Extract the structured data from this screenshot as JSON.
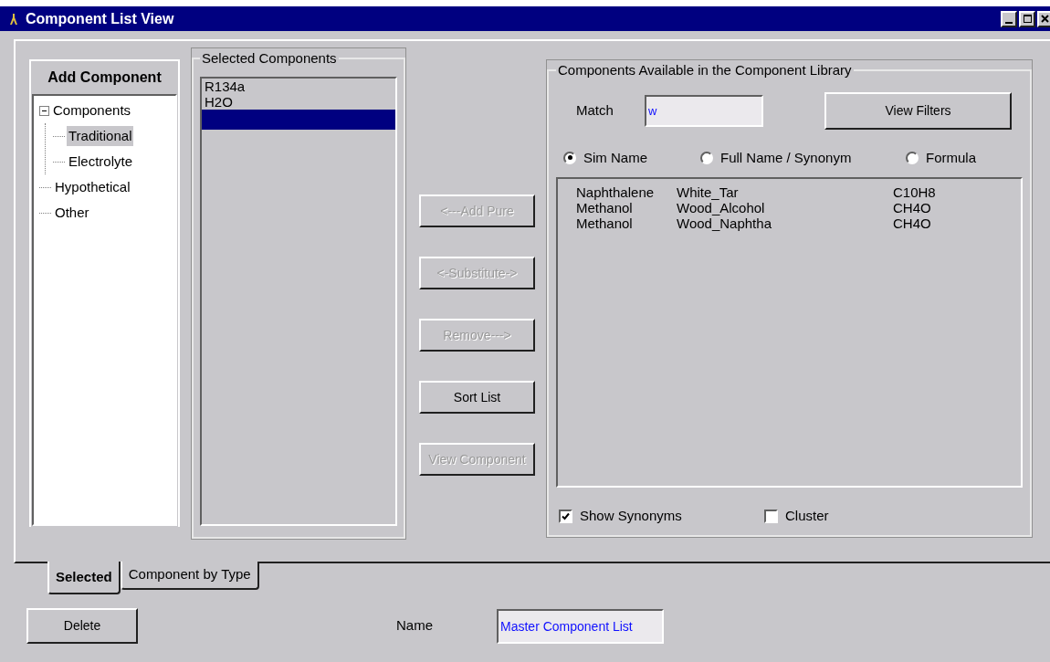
{
  "window": {
    "title": "Component List View"
  },
  "add_component": {
    "title": "Add Component",
    "tree": [
      {
        "label": "Components",
        "expanded": true,
        "selected": false,
        "children": [
          {
            "label": "Traditional",
            "selected": true
          },
          {
            "label": "Electrolyte",
            "selected": false
          }
        ]
      },
      {
        "label": "Hypothetical",
        "selected": false
      },
      {
        "label": "Other",
        "selected": false
      }
    ]
  },
  "selected_components": {
    "title": "Selected Components",
    "items": [
      {
        "text": "R134a",
        "selected": false
      },
      {
        "text": "H2O",
        "selected": false
      }
    ],
    "empty_row_selected": true
  },
  "actions": [
    {
      "label": "<---Add Pure",
      "disabled": true
    },
    {
      "label": "<-Substitute->",
      "disabled": true
    },
    {
      "label": "Remove--->",
      "disabled": true
    },
    {
      "label": "Sort List",
      "disabled": false
    },
    {
      "label": "View Component",
      "disabled": true
    }
  ],
  "library": {
    "title": "Components Available in the Component Library",
    "match_label": "Match",
    "match_value": "w",
    "view_filters": "View Filters",
    "search_modes": [
      {
        "label": "Sim Name",
        "selected": true
      },
      {
        "label": "Full Name / Synonym",
        "selected": false
      },
      {
        "label": "Formula",
        "selected": false
      }
    ],
    "rows": [
      {
        "sim_name": "Naphthalene",
        "synonym": "White_Tar",
        "formula": "C10H8"
      },
      {
        "sim_name": "Methanol",
        "synonym": "Wood_Alcohol",
        "formula": "CH4O"
      },
      {
        "sim_name": "Methanol",
        "synonym": "Wood_Naphtha",
        "formula": "CH4O"
      }
    ],
    "options": [
      {
        "label": "Show Synonyms",
        "checked": true
      },
      {
        "label": "Cluster",
        "checked": false
      }
    ]
  },
  "tabs": [
    {
      "label": "Selected",
      "selected": true
    },
    {
      "label": "Component by Type",
      "selected": false
    }
  ],
  "footer": {
    "delete": "Delete",
    "name_label": "Name",
    "name_value": "Master Component List"
  }
}
